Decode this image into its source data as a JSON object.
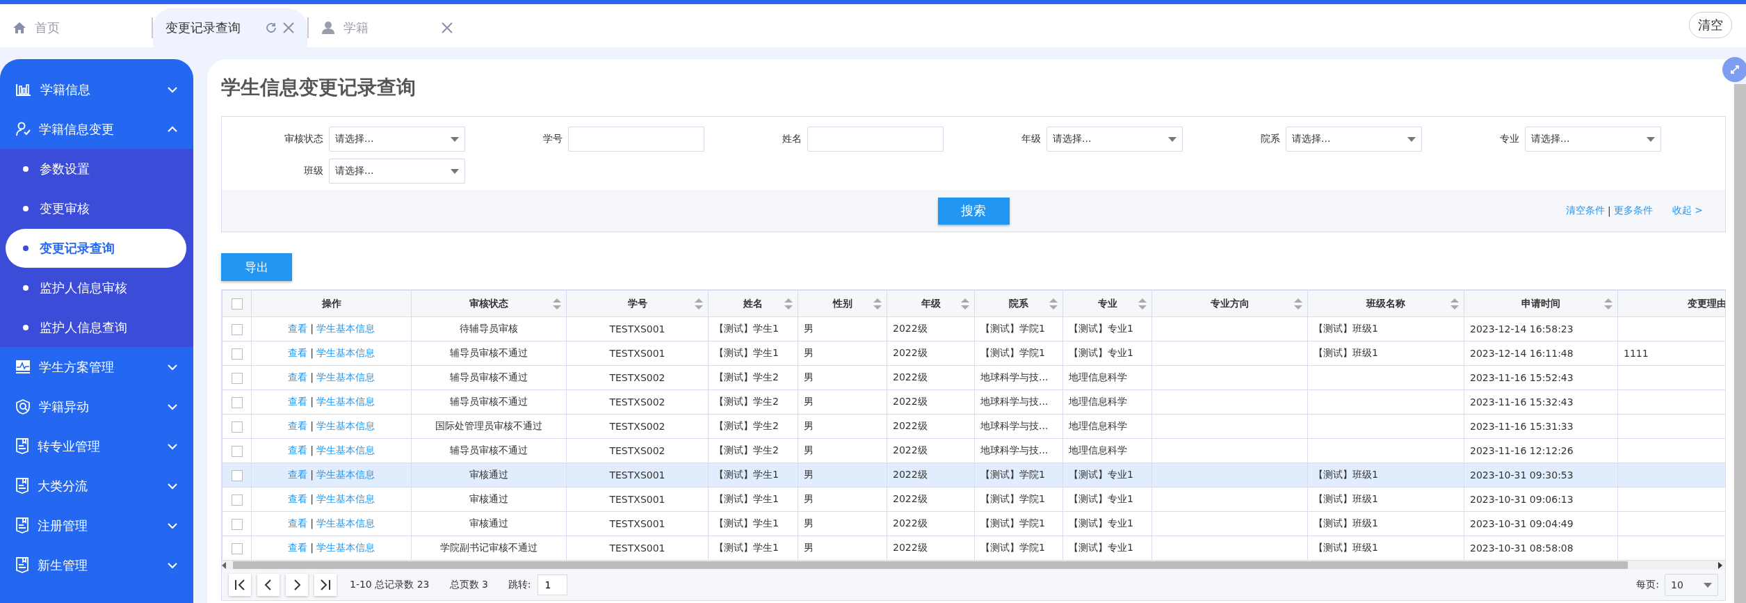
{
  "tabs": [
    {
      "label": "首页",
      "kind": "home",
      "selected": false,
      "closable": false,
      "refreshable": false
    },
    {
      "label": "变更记录查询",
      "kind": "plain",
      "selected": true,
      "closable": true,
      "refreshable": true
    },
    {
      "label": "学籍",
      "kind": "user",
      "selected": false,
      "closable": true,
      "refreshable": false
    }
  ],
  "clear_button": "清空",
  "sidebar": {
    "items": [
      {
        "label": "学籍信息",
        "kind": "chart",
        "expanded": false
      },
      {
        "label": "学籍信息变更",
        "kind": "user",
        "expanded": true,
        "children": [
          {
            "label": "参数设置",
            "selected": false
          },
          {
            "label": "变更审核",
            "selected": false
          },
          {
            "label": "变更记录查询",
            "selected": true
          },
          {
            "label": "监护人信息审核",
            "selected": false
          },
          {
            "label": "监护人信息查询",
            "selected": false
          }
        ]
      },
      {
        "label": "学生方案管理",
        "kind": "monitor",
        "expanded": false
      },
      {
        "label": "学籍异动",
        "kind": "shield",
        "expanded": false
      },
      {
        "label": "转专业管理",
        "kind": "book",
        "expanded": false
      },
      {
        "label": "大类分流",
        "kind": "book",
        "expanded": false
      },
      {
        "label": "注册管理",
        "kind": "book",
        "expanded": false
      },
      {
        "label": "新生管理",
        "kind": "book",
        "expanded": false
      }
    ]
  },
  "page_title": "学生信息变更记录查询",
  "filters": {
    "fields": [
      {
        "label": "审核状态",
        "kind": "select",
        "placeholder": "请选择..."
      },
      {
        "label": "学号",
        "kind": "input"
      },
      {
        "label": "姓名",
        "kind": "input"
      },
      {
        "label": "年级",
        "kind": "select",
        "placeholder": "请选择..."
      },
      {
        "label": "院系",
        "kind": "select",
        "placeholder": "请选择..."
      },
      {
        "label": "专业",
        "kind": "select",
        "placeholder": "请选择..."
      },
      {
        "label": "班级",
        "kind": "select",
        "placeholder": "请选择..."
      }
    ],
    "search_button": "搜索",
    "clear_link": "清空条件",
    "separator": "|",
    "more_link": "更多条件",
    "collapse_link": "收起 >"
  },
  "export_button": "导出",
  "table": {
    "header_checked": false,
    "actions_header": "操作",
    "columns": [
      {
        "label": "审核状态",
        "sortable": true
      },
      {
        "label": "学号",
        "sortable": true
      },
      {
        "label": "姓名",
        "sortable": true
      },
      {
        "label": "性别",
        "sortable": true
      },
      {
        "label": "年级",
        "sortable": true
      },
      {
        "label": "院系",
        "sortable": true
      },
      {
        "label": "专业",
        "sortable": true
      },
      {
        "label": "专业方向",
        "sortable": true
      },
      {
        "label": "班级名称",
        "sortable": true
      },
      {
        "label": "申请时间",
        "sortable": true
      },
      {
        "label": "变更理由",
        "sortable": false
      }
    ],
    "rows": [
      {
        "checked": false,
        "highlighted": false,
        "view_link": "查看",
        "separator": "|",
        "info_link": "学生基本信息",
        "cells": [
          "待辅导员审核",
          "TESTXS001",
          "【测试】学生1",
          "男",
          "2022级",
          "【测试】学院1",
          "【测试】专业1",
          null,
          "【测试】班级1",
          "2023-12-14 16:58:23",
          null
        ]
      },
      {
        "checked": false,
        "highlighted": false,
        "view_link": "查看",
        "separator": "|",
        "info_link": "学生基本信息",
        "cells": [
          "辅导员审核不通过",
          "TESTXS001",
          "【测试】学生1",
          "男",
          "2022级",
          "【测试】学院1",
          "【测试】专业1",
          null,
          "【测试】班级1",
          "2023-12-14 16:11:48",
          "1111"
        ]
      },
      {
        "checked": false,
        "highlighted": false,
        "view_link": "查看",
        "separator": "|",
        "info_link": "学生基本信息",
        "cells": [
          "辅导员审核不通过",
          "TESTXS002",
          "【测试】学生2",
          "男",
          "2022级",
          "地球科学与技...",
          "地理信息科学",
          null,
          null,
          "2023-11-16 15:52:43",
          null
        ]
      },
      {
        "checked": false,
        "highlighted": false,
        "view_link": "查看",
        "separator": "|",
        "info_link": "学生基本信息",
        "cells": [
          "辅导员审核不通过",
          "TESTXS002",
          "【测试】学生2",
          "男",
          "2022级",
          "地球科学与技...",
          "地理信息科学",
          null,
          null,
          "2023-11-16 15:32:43",
          null
        ]
      },
      {
        "checked": false,
        "highlighted": false,
        "view_link": "查看",
        "separator": "|",
        "info_link": "学生基本信息",
        "cells": [
          "国际处管理员审核不通过",
          "TESTXS002",
          "【测试】学生2",
          "男",
          "2022级",
          "地球科学与技...",
          "地理信息科学",
          null,
          null,
          "2023-11-16 15:31:33",
          null
        ]
      },
      {
        "checked": false,
        "highlighted": false,
        "view_link": "查看",
        "separator": "|",
        "info_link": "学生基本信息",
        "cells": [
          "辅导员审核不通过",
          "TESTXS002",
          "【测试】学生2",
          "男",
          "2022级",
          "地球科学与技...",
          "地理信息科学",
          null,
          null,
          "2023-11-16 12:12:26",
          null
        ]
      },
      {
        "checked": false,
        "highlighted": true,
        "view_link": "查看",
        "separator": "|",
        "info_link": "学生基本信息",
        "cells": [
          "审核通过",
          "TESTXS001",
          "【测试】学生1",
          "男",
          "2022级",
          "【测试】学院1",
          "【测试】专业1",
          null,
          "【测试】班级1",
          "2023-10-31 09:30:53",
          null
        ]
      },
      {
        "checked": false,
        "highlighted": false,
        "view_link": "查看",
        "separator": "|",
        "info_link": "学生基本信息",
        "cells": [
          "审核通过",
          "TESTXS001",
          "【测试】学生1",
          "男",
          "2022级",
          "【测试】学院1",
          "【测试】专业1",
          null,
          "【测试】班级1",
          "2023-10-31 09:06:13",
          null
        ]
      },
      {
        "checked": false,
        "highlighted": false,
        "view_link": "查看",
        "separator": "|",
        "info_link": "学生基本信息",
        "cells": [
          "审核通过",
          "TESTXS001",
          "【测试】学生1",
          "男",
          "2022级",
          "【测试】学院1",
          "【测试】专业1",
          null,
          "【测试】班级1",
          "2023-10-31 09:04:49",
          null
        ]
      },
      {
        "checked": false,
        "highlighted": false,
        "view_link": "查看",
        "separator": "|",
        "info_link": "学生基本信息",
        "cells": [
          "学院副书记审核不通过",
          "TESTXS001",
          "【测试】学生1",
          "男",
          "2022级",
          "【测试】学院1",
          "【测试】专业1",
          null,
          "【测试】班级1",
          "2023-10-31 08:58:08",
          null
        ]
      }
    ]
  },
  "pagination": {
    "range": "1-10 总记录数 23",
    "pages": "总页数 3",
    "jump_label": "跳转:",
    "jump_value": "1",
    "per_page_label": "每页:",
    "per_page_value": "10"
  }
}
